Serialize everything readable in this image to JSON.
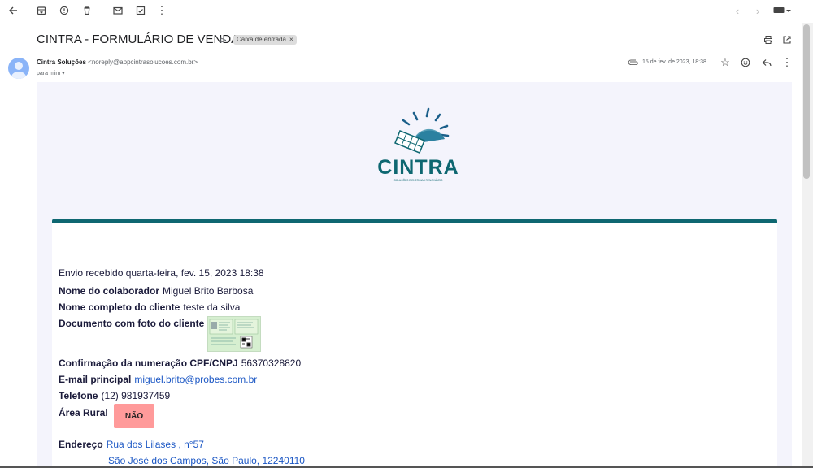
{
  "toolbar": {
    "back_icon": "arrow-left-icon",
    "archive_icon": "archive-icon",
    "spam_icon": "report-icon",
    "delete_icon": "trash-icon",
    "unread_icon": "mail-icon",
    "move_icon": "move-to-icon",
    "more_icon": "more-vert-icon",
    "prev_icon": "chevron-left-icon",
    "next_icon": "chevron-right-icon",
    "input_icon": "keyboard-icon"
  },
  "email": {
    "subject": "CINTRA - FORMULÁRIO DE VENDA",
    "label": "Caixa de entrada",
    "label_close": "×",
    "sender_name": "Cintra Soluções",
    "sender_email": "<noreply@appcintrasolucoes.com.br>",
    "to": "para mim",
    "date": "15 de fev. de 2023, 18:38"
  },
  "brand": {
    "name": "CINTRA",
    "tagline": "SOLUÇÕES E ENERGIAS RENOVÁVEIS",
    "accent": "#0e6771",
    "sun": "#1b5f8a"
  },
  "form": {
    "received": "Envio recebido quarta-feira, fev. 15, 2023 18:38",
    "collaborator_label": "Nome do colaborador",
    "collaborator_value": "Miguel Brito Barbosa",
    "client_label": "Nome completo do cliente",
    "client_value": "teste da silva",
    "document_label": "Documento com foto do cliente",
    "cpf_label": "Confirmação da numeração CPF/CNPJ",
    "cpf_value": "56370328820",
    "email_label": "E-mail principal",
    "email_value": "miguel.brito@probes.com.br",
    "phone_label": "Telefone",
    "phone_value": "(12) 981937459",
    "rural_label": "Área Rural",
    "rural_value": "NÃO",
    "address_label": "Endereço",
    "address_line1": "Rua dos Lilases , n°57",
    "address_line2": "São José dos Campos, São Paulo, 12240110"
  }
}
